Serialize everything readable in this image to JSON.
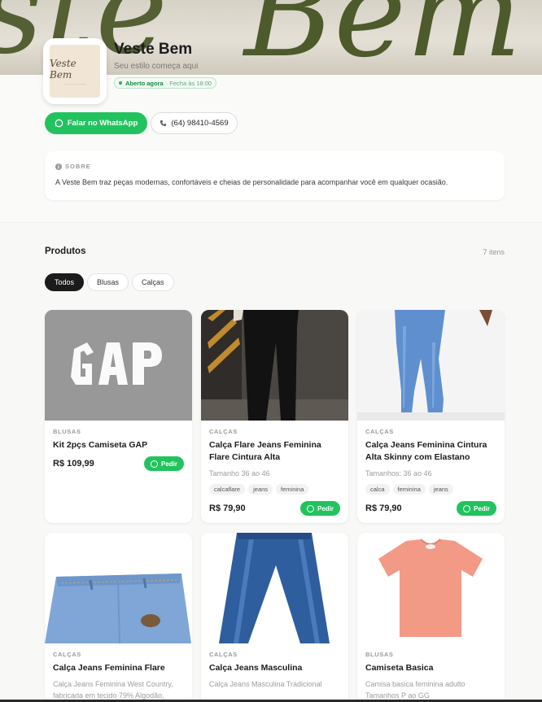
{
  "store": {
    "name": "Veste Bem",
    "tagline": "Seu estilo começa aqui",
    "logo_text": "Veste Bem",
    "status_open": "Aberto agora",
    "status_close": "· Fecha às 18:00",
    "whatsapp_label": "Falar no WhatsApp",
    "phone_label": "(64) 98410-4569"
  },
  "about": {
    "title": "SOBRE",
    "text": "A Veste Bem traz peças modernas, confortáveis e cheias de personalidade para acompanhar você em qualquer ocasião."
  },
  "products_section": {
    "title": "Produtos",
    "count": "7 itens",
    "filters": [
      "Todos",
      "Blusas",
      "Calças"
    ],
    "active_filter": "Todos"
  },
  "order_label": "Pedir",
  "products": [
    {
      "category": "BLUSAS",
      "name": "Kit 2pçs Camiseta GAP",
      "desc": "",
      "tags": [],
      "price": "R$ 109,99"
    },
    {
      "category": "CALÇAS",
      "name": "Calça Flare Jeans Feminina Flare Cintura Alta",
      "desc": "Tamanho 36 ao 46",
      "tags": [
        "calcaflare",
        "jeans",
        "feminina"
      ],
      "price": "R$ 79,90"
    },
    {
      "category": "CALÇAS",
      "name": "Calça Jeans Feminina Cintura Alta Skinny com Elastano",
      "desc": "Tamanhos: 36 ao 46",
      "tags": [
        "calca",
        "feminina",
        "jeans"
      ],
      "price": "R$ 79,90"
    },
    {
      "category": "CALÇAS",
      "name": "Calça Jeans Feminina Flare",
      "desc": "Calça Jeans Feminina West Country, fabricada em tecido 79% Algodão,",
      "tags": [],
      "price": ""
    },
    {
      "category": "CALÇAS",
      "name": "Calça Jeans Masculina",
      "desc": "Calça Jeans Masculina Tradicional",
      "tags": [],
      "price": ""
    },
    {
      "category": "BLUSAS",
      "name": "Camiseta Basica",
      "desc": "Camisa basica feminina adulto Tamanhos P ao GG",
      "tags": [],
      "price": ""
    }
  ],
  "colors": {
    "whatsapp_green": "#22c35e",
    "banner_olive": "#4d5a2b",
    "active_chip": "#1b1b1b"
  }
}
